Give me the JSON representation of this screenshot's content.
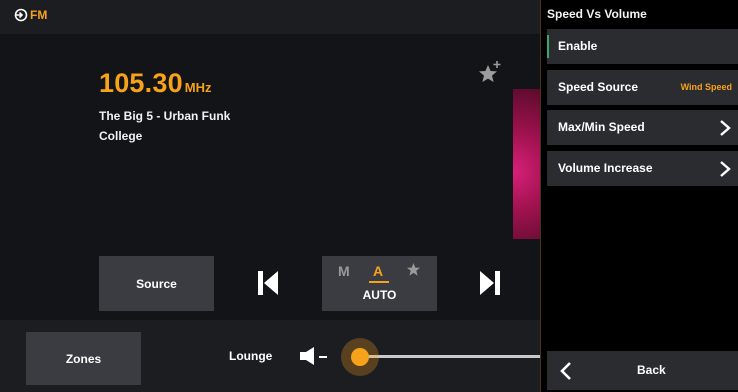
{
  "source": {
    "band": "FM",
    "icon": "source-input-icon"
  },
  "tuner": {
    "frequency": "105.30",
    "unit": "MHz",
    "station": "The Big 5 - Urban Funk College",
    "favorite_icon": "star-add-icon"
  },
  "controls": {
    "source_label": "Source",
    "mode_m": "M",
    "mode_a": "A",
    "mode_label": "AUTO",
    "prev_icon": "skip-previous-icon",
    "next_icon": "skip-next-icon"
  },
  "bottom": {
    "zones_label": "Zones",
    "zone_name": "Lounge",
    "volume_fraction": 0.0
  },
  "panel": {
    "title": "Speed Vs Volume",
    "rows": [
      {
        "label": "Enable"
      },
      {
        "label": "Speed Source",
        "value": "Wind Speed"
      },
      {
        "label": "Max/Min Speed"
      },
      {
        "label": "Volume Increase"
      }
    ],
    "back_label": "Back"
  },
  "colors": {
    "accent": "#f7a21b",
    "enable_indicator": "#3aa76d"
  }
}
